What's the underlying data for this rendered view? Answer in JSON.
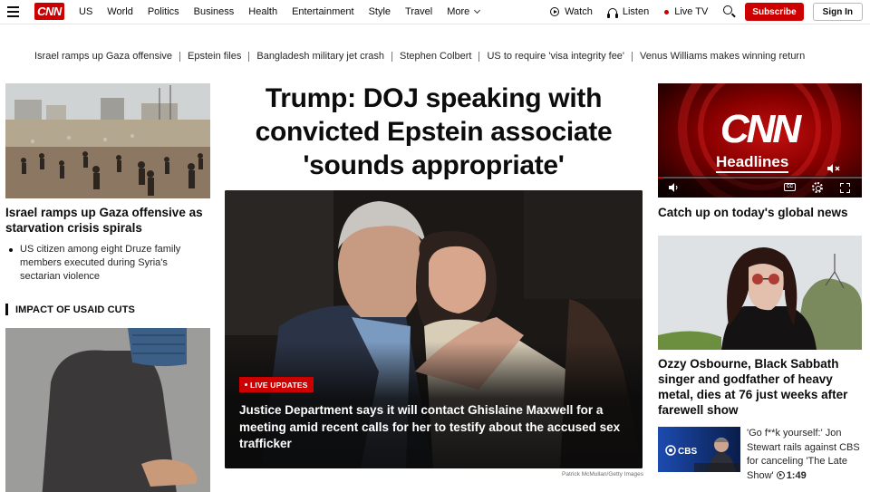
{
  "brand": {
    "logo_text": "CNN",
    "accent": "#cc0000"
  },
  "nav": {
    "links": [
      "US",
      "World",
      "Politics",
      "Business",
      "Health",
      "Entertainment",
      "Style",
      "Travel",
      "More"
    ],
    "watch": "Watch",
    "listen": "Listen",
    "live_tv": "Live TV",
    "subscribe": "Subscribe",
    "sign_in": "Sign In"
  },
  "trending": [
    "Israel ramps up Gaza offensive",
    "Epstein files",
    "Bangladesh military jet crash",
    "Stephen Colbert",
    "US to require 'visa integrity fee'",
    "Venus Williams makes winning return"
  ],
  "left": {
    "story1_title": "Israel ramps up Gaza offensive as starvation crisis spirals",
    "story1_bullet": "US citizen among eight Druze family members executed during Syria's sectarian violence",
    "section_label": "IMPACT OF USAID CUTS"
  },
  "center": {
    "headline": "Trump: DOJ speaking with convicted Epstein associate 'sounds appropriate'",
    "badge": "LIVE UPDATES",
    "caption": "Justice Department says it will contact Ghislaine Maxwell for a meeting amid recent calls for her to testify about the accused sex trafficker",
    "credit": "Patrick McMullan/Getty Images"
  },
  "right": {
    "video_logo": "CNN",
    "video_label": "Headlines",
    "story1_title": "Catch up on today's global news",
    "story2_title": "Ozzy Osbourne, Black Sabbath singer and godfather of heavy metal, dies at 76 just weeks after farewell show",
    "story3_text": "'Go f**k yourself:' Jon Stewart rails against CBS for canceling 'The Late Show'",
    "story3_duration": "1:49",
    "thumb_logo": "CBS"
  }
}
